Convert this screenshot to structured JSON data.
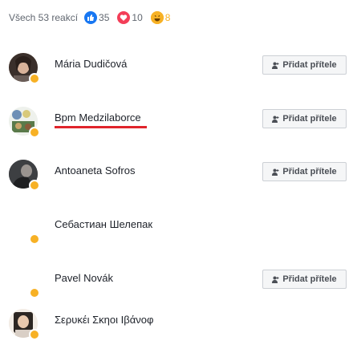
{
  "tabs": {
    "all_label": "Všech 53 reakcí",
    "like_count": "35",
    "love_count": "10",
    "haha_count": "8"
  },
  "colors": {
    "like": "#1877f2",
    "love": "#f33e58",
    "haha": "#f7b125",
    "active_underline": "#e0242b"
  },
  "add_friend_label": "Přidat přítele",
  "people": [
    {
      "name": "Mária Dudičová",
      "reaction": "haha",
      "has_button": true,
      "avatar": "photo"
    },
    {
      "name": "Bpm Medzilaborce",
      "reaction": "haha",
      "has_button": true,
      "avatar": "logo"
    },
    {
      "name": "Antoaneta Sofros",
      "reaction": "haha",
      "has_button": true,
      "avatar": "photo"
    },
    {
      "name": "Себастиан Шелепак",
      "reaction": "haha",
      "has_button": false,
      "avatar": "blank"
    },
    {
      "name": "Pavel Novák",
      "reaction": "haha",
      "has_button": true,
      "avatar": "blank"
    },
    {
      "name": "Σερυκέι Σκηοι Ιβάνοφ",
      "reaction": "haha",
      "has_button": false,
      "avatar": "photo"
    }
  ]
}
